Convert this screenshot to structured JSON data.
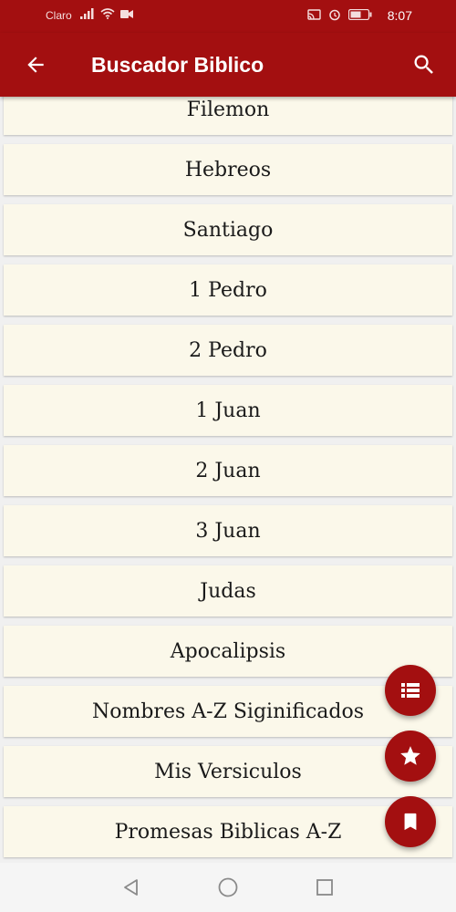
{
  "status_bar": {
    "carrier": "Claro",
    "time": "8:07"
  },
  "app_bar": {
    "title": "Buscador Biblico",
    "back_icon": "arrow-left-icon",
    "search_icon": "search-icon"
  },
  "books": {
    "items": [
      "Filemon",
      "Hebreos",
      "Santiago",
      "1 Pedro",
      "2 Pedro",
      "1 Juan",
      "2 Juan",
      "3 Juan",
      "Judas",
      "Apocalipsis",
      "Nombres A-Z Siginificados",
      "Mis Versiculos",
      "Promesas Biblicas A-Z"
    ]
  },
  "fabs": {
    "list_icon": "list-icon",
    "star_icon": "star-icon",
    "bookmark_icon": "bookmark-icon"
  },
  "nav": {
    "back_icon": "triangle-back-icon",
    "home_icon": "circle-home-icon",
    "recents_icon": "square-recents-icon"
  },
  "colors": {
    "primary": "#a30f10",
    "item_background": "#fbf8ea",
    "text": "#1a1a1a"
  }
}
